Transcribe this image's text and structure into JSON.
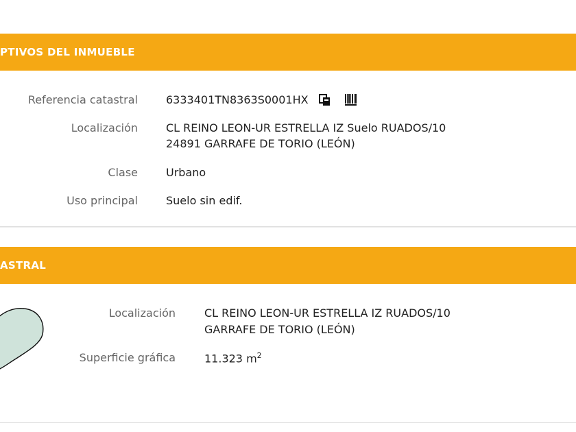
{
  "section_1": {
    "title": "PTIVOS DEL INMUEBLE",
    "referencia_label": "Referencia catastral",
    "referencia_value": "6333401TN8363S0001HX",
    "localizacion_label": "Localización",
    "localizacion_line1": "CL REINO LEON-UR ESTRELLA IZ Suelo RUADOS/10",
    "localizacion_line2": "24891 GARRAFE DE TORIO (LEÓN)",
    "clase_label": "Clase",
    "clase_value": "Urbano",
    "uso_label": "Uso principal",
    "uso_value": "Suelo sin edif.",
    "icons": [
      "copy-icon",
      "barcode-icon"
    ]
  },
  "section_2": {
    "title": "ASTRAL",
    "localizacion_label": "Localización",
    "localizacion_line1": "CL REINO LEON-UR ESTRELLA IZ RUADOS/10",
    "localizacion_line2": "GARRAFE DE TORIO (LEÓN)",
    "superficie_label": "Superficie gráfica",
    "superficie_value": "11.323 m",
    "superficie_unit_exp": "2"
  },
  "colors": {
    "header_band": "#f5a814",
    "label_text": "#666666",
    "value_text": "#222222",
    "parcel_fill": "#cfe3da"
  }
}
